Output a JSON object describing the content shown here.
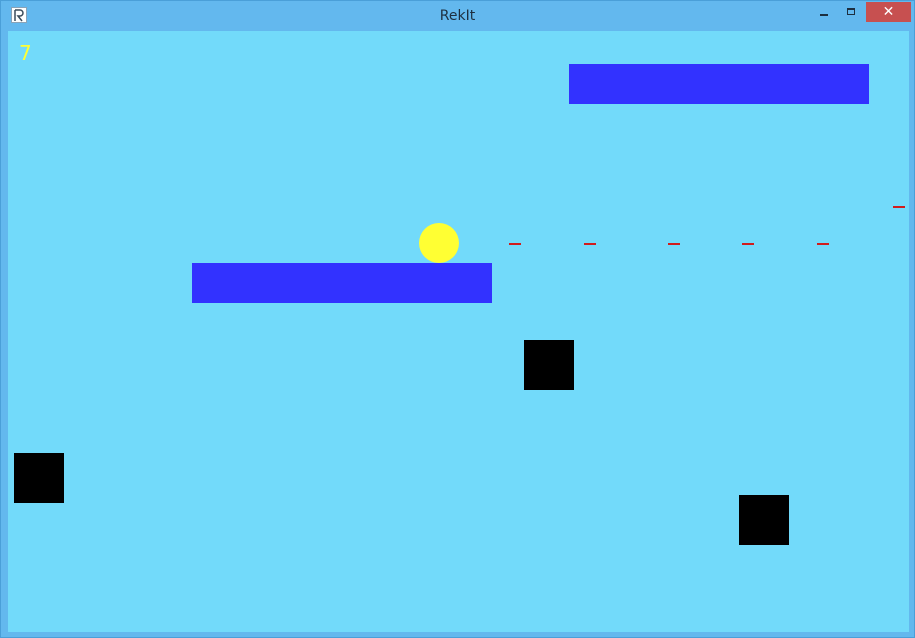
{
  "window": {
    "title": "RekIt",
    "app_icon": "app-logo-icon",
    "controls": {
      "minimize": "minimize-icon",
      "maximize": "maximize-icon",
      "close": "close-icon",
      "close_glyph": "✕"
    }
  },
  "game": {
    "score": "7",
    "colors": {
      "background": "#72dafa",
      "platform": "#3232ff",
      "obstacle": "#000000",
      "ball": "#ffff33",
      "trail": "#d11c1c",
      "score_text": "#ffff33"
    }
  }
}
